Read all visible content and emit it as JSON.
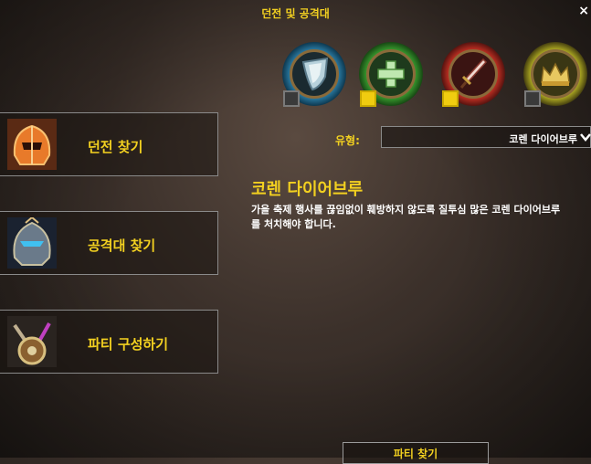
{
  "window": {
    "title": "던전 및 공격대",
    "close_glyph": "×"
  },
  "roles": [
    {
      "name": "shield-role-icon",
      "checked": false,
      "ring_color": "#2c7fa8"
    },
    {
      "name": "heal-role-icon",
      "checked": true,
      "ring_color": "#2f8a2a"
    },
    {
      "name": "damage-role-icon",
      "checked": true,
      "ring_color": "#a82a1e"
    },
    {
      "name": "leader-role-icon",
      "checked": false,
      "ring_color": "#9a9a20"
    }
  ],
  "type_selector": {
    "label": "유형:",
    "value": "코렌 다이어브루"
  },
  "dungeon": {
    "title": "코렌 다이어브루",
    "description": "가을 축제 행사를 끊임없이 훼방하지 않도록 질투심 많은 코렌 다이어브루를 처치해야 합니다."
  },
  "menu": {
    "dungeon_finder": "던전 찾기",
    "raid_finder": "공격대 찾기",
    "group_builder": "파티 구성하기"
  },
  "find_group_button": "파티 찾기",
  "colors": {
    "accent_yellow": "#f2d020"
  }
}
